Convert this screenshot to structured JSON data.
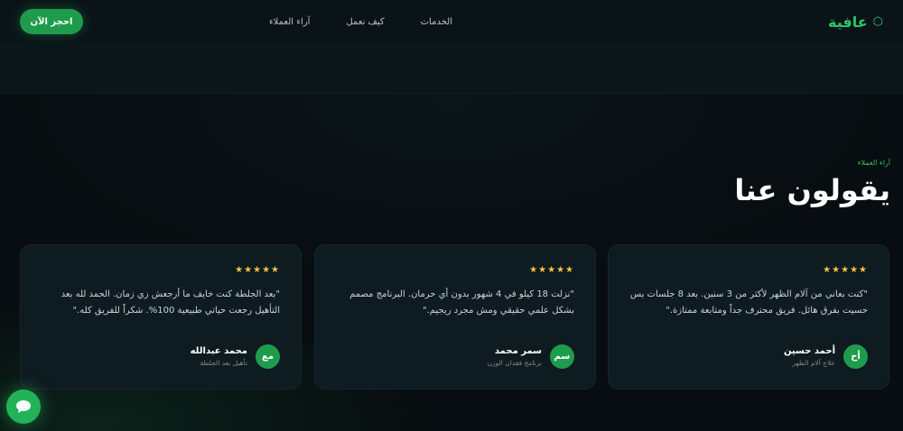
{
  "nav": {
    "logo": "عافية",
    "logo_icon": "hexagon-icon",
    "links": [
      "الخدمات",
      "كيف نعمل",
      "آراء العملاء"
    ],
    "cta": "احجز الآن"
  },
  "section": {
    "eyebrow": "آراء العملاء",
    "title": "يقولون عنا"
  },
  "testimonials": [
    {
      "stars": "★★★★★",
      "quote": "\"كنت بعاني من آلام الظهر لأكثر من 3 سنين. بعد 8 جلسات بس حسيت بفرق هائل. فريق محترف جداً ومتابعة ممتازة.\"",
      "initials": "أح",
      "name": "أحمد حسين",
      "role": "علاج آلام الظهر"
    },
    {
      "stars": "★★★★★",
      "quote": "\"نزلت 18 كيلو في 4 شهور بدون أي حرمان. البرنامج مصمم بشكل علمي حقيقي ومش مجرد ريجيم.\"",
      "initials": "سم",
      "name": "سمر محمد",
      "role": "برنامج فقدان الوزن"
    },
    {
      "stars": "★★★★★",
      "quote": "\"بعد الجلطة كنت خايف ما أرجعش زي زمان. الحمد لله بعد التأهيل رجعت حياتي طبيعية 100%. شكراً للفريق كله.\"",
      "initials": "مع",
      "name": "محمد عبدالله",
      "role": "تأهيل بعد الجلطة"
    }
  ],
  "chat_icon": "chat-bubble-icon",
  "colors": {
    "accent": "#2ec464",
    "button": "#1e9c4c",
    "background": "#070d10",
    "card": "#0e1b21",
    "star": "#f5c242"
  }
}
